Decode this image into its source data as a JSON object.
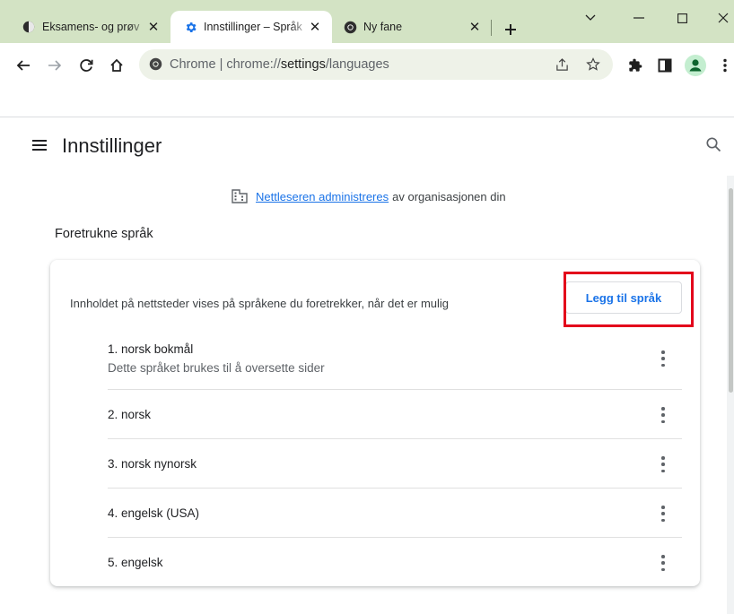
{
  "tabs": [
    {
      "title": "Eksamens- og prøv",
      "icon": "exam-site-icon",
      "close": "✕"
    },
    {
      "title": "Innstillinger – Språk",
      "icon": "settings-gear-icon",
      "close": "✕",
      "active": true
    },
    {
      "title": "Ny fane",
      "icon": "chrome-icon",
      "close": "✕"
    }
  ],
  "toolbar": {
    "omnibox_site": "Chrome",
    "omnibox_sep": " | ",
    "url_prefix": "chrome://",
    "url_host": "settings",
    "url_path": "/languages"
  },
  "settings": {
    "title": "Innstillinger",
    "managed_link": "Nettleseren administreres",
    "managed_rest": "av organisasjonen din",
    "section_title": "Foretrukne språk",
    "card_description": "Innholdet på nettsteder vises på språkene du foretrekker, når det er mulig",
    "add_button": "Legg til språk",
    "languages": [
      {
        "name": "1. norsk bokmål",
        "sub": "Dette språket brukes til å oversette sider"
      },
      {
        "name": "2. norsk"
      },
      {
        "name": "3. norsk nynorsk"
      },
      {
        "name": "4. engelsk (USA)"
      },
      {
        "name": "5. engelsk"
      }
    ]
  },
  "colors": {
    "tabstrip": "#d3e3c4",
    "accent": "#1a73e8",
    "highlight": "#e3001b"
  }
}
